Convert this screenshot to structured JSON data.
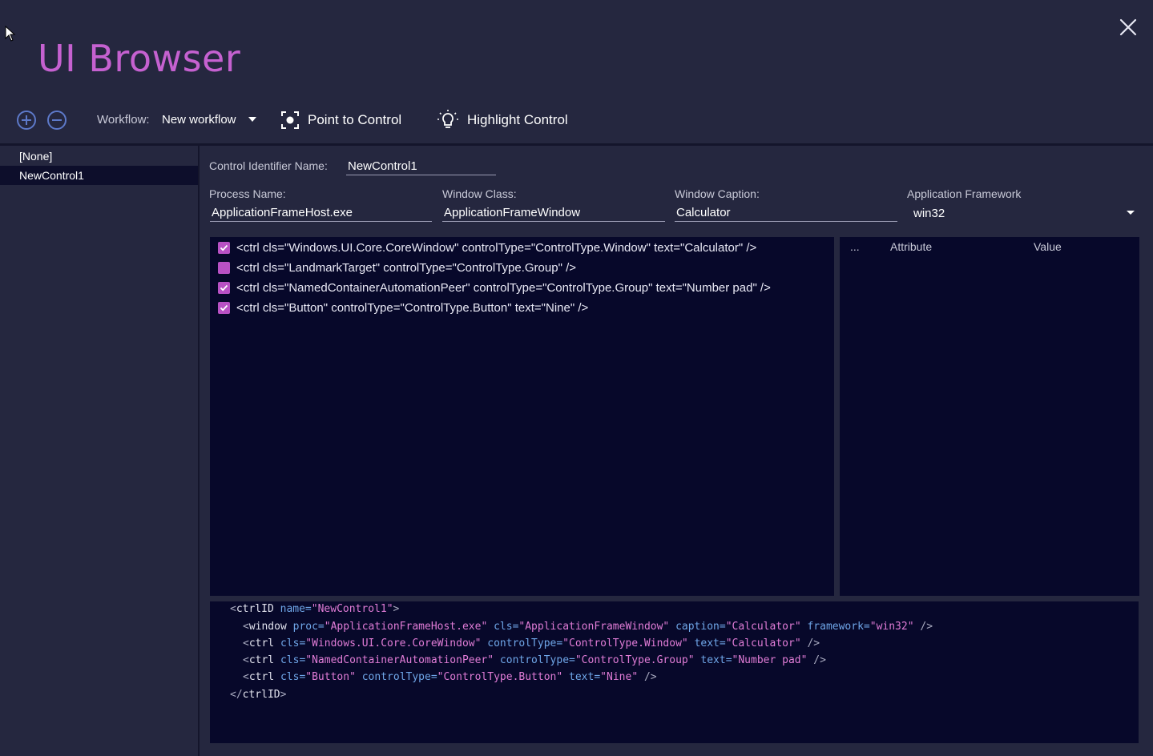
{
  "app": {
    "title": "UI Browser"
  },
  "toolbar": {
    "workflow_label": "Workflow:",
    "workflow_value": "New workflow",
    "point_label": "Point to Control",
    "highlight_label": "Highlight Control"
  },
  "sidebar": {
    "items": [
      {
        "label": "[None]",
        "selected": false
      },
      {
        "label": "NewControl1",
        "selected": true
      }
    ]
  },
  "form": {
    "identifier_label": "Control Identifier Name:",
    "identifier_value": "NewControl1",
    "process_label": "Process Name:",
    "process_value": "ApplicationFrameHost.exe",
    "class_label": "Window Class:",
    "class_value": "ApplicationFrameWindow",
    "caption_label": "Window Caption:",
    "caption_value": "Calculator",
    "framework_label": "Application Framework",
    "framework_value": "win32"
  },
  "tree": {
    "rows": [
      {
        "text": "<ctrl cls=\"Windows.UI.Core.CoreWindow\" controlType=\"ControlType.Window\" text=\"Calculator\" />",
        "checked": true
      },
      {
        "text": "<ctrl cls=\"LandmarkTarget\" controlType=\"ControlType.Group\" />",
        "checked": false
      },
      {
        "text": "<ctrl cls=\"NamedContainerAutomationPeer\" controlType=\"ControlType.Group\" text=\"Number pad\" />",
        "checked": true
      },
      {
        "text": "<ctrl cls=\"Button\" controlType=\"ControlType.Button\" text=\"Nine\" />",
        "checked": true
      }
    ]
  },
  "attributes": {
    "col_more": "...",
    "col_attribute": "Attribute",
    "col_value": "Value"
  },
  "xml": {
    "root_tag": "ctrlID",
    "root_name": "NewControl1",
    "window": {
      "proc": "ApplicationFrameHost.exe",
      "cls": "ApplicationFrameWindow",
      "caption": "Calculator",
      "framework": "win32"
    },
    "ctrls": [
      {
        "cls": "Windows.UI.Core.CoreWindow",
        "controlType": "ControlType.Window",
        "text": "Calculator"
      },
      {
        "cls": "NamedContainerAutomationPeer",
        "controlType": "ControlType.Group",
        "text": "Number pad"
      },
      {
        "cls": "Button",
        "controlType": "ControlType.Button",
        "text": "Nine"
      }
    ]
  },
  "colors": {
    "accent": "#c561d0",
    "checkbox": "#b851c4",
    "panel_bg": "#07082a",
    "window_bg": "#25273f"
  },
  "icons": [
    "cursor-icon",
    "close-icon",
    "add-circle-icon",
    "remove-circle-icon",
    "target-icon",
    "lightbulb-icon",
    "checkmark-icon"
  ]
}
